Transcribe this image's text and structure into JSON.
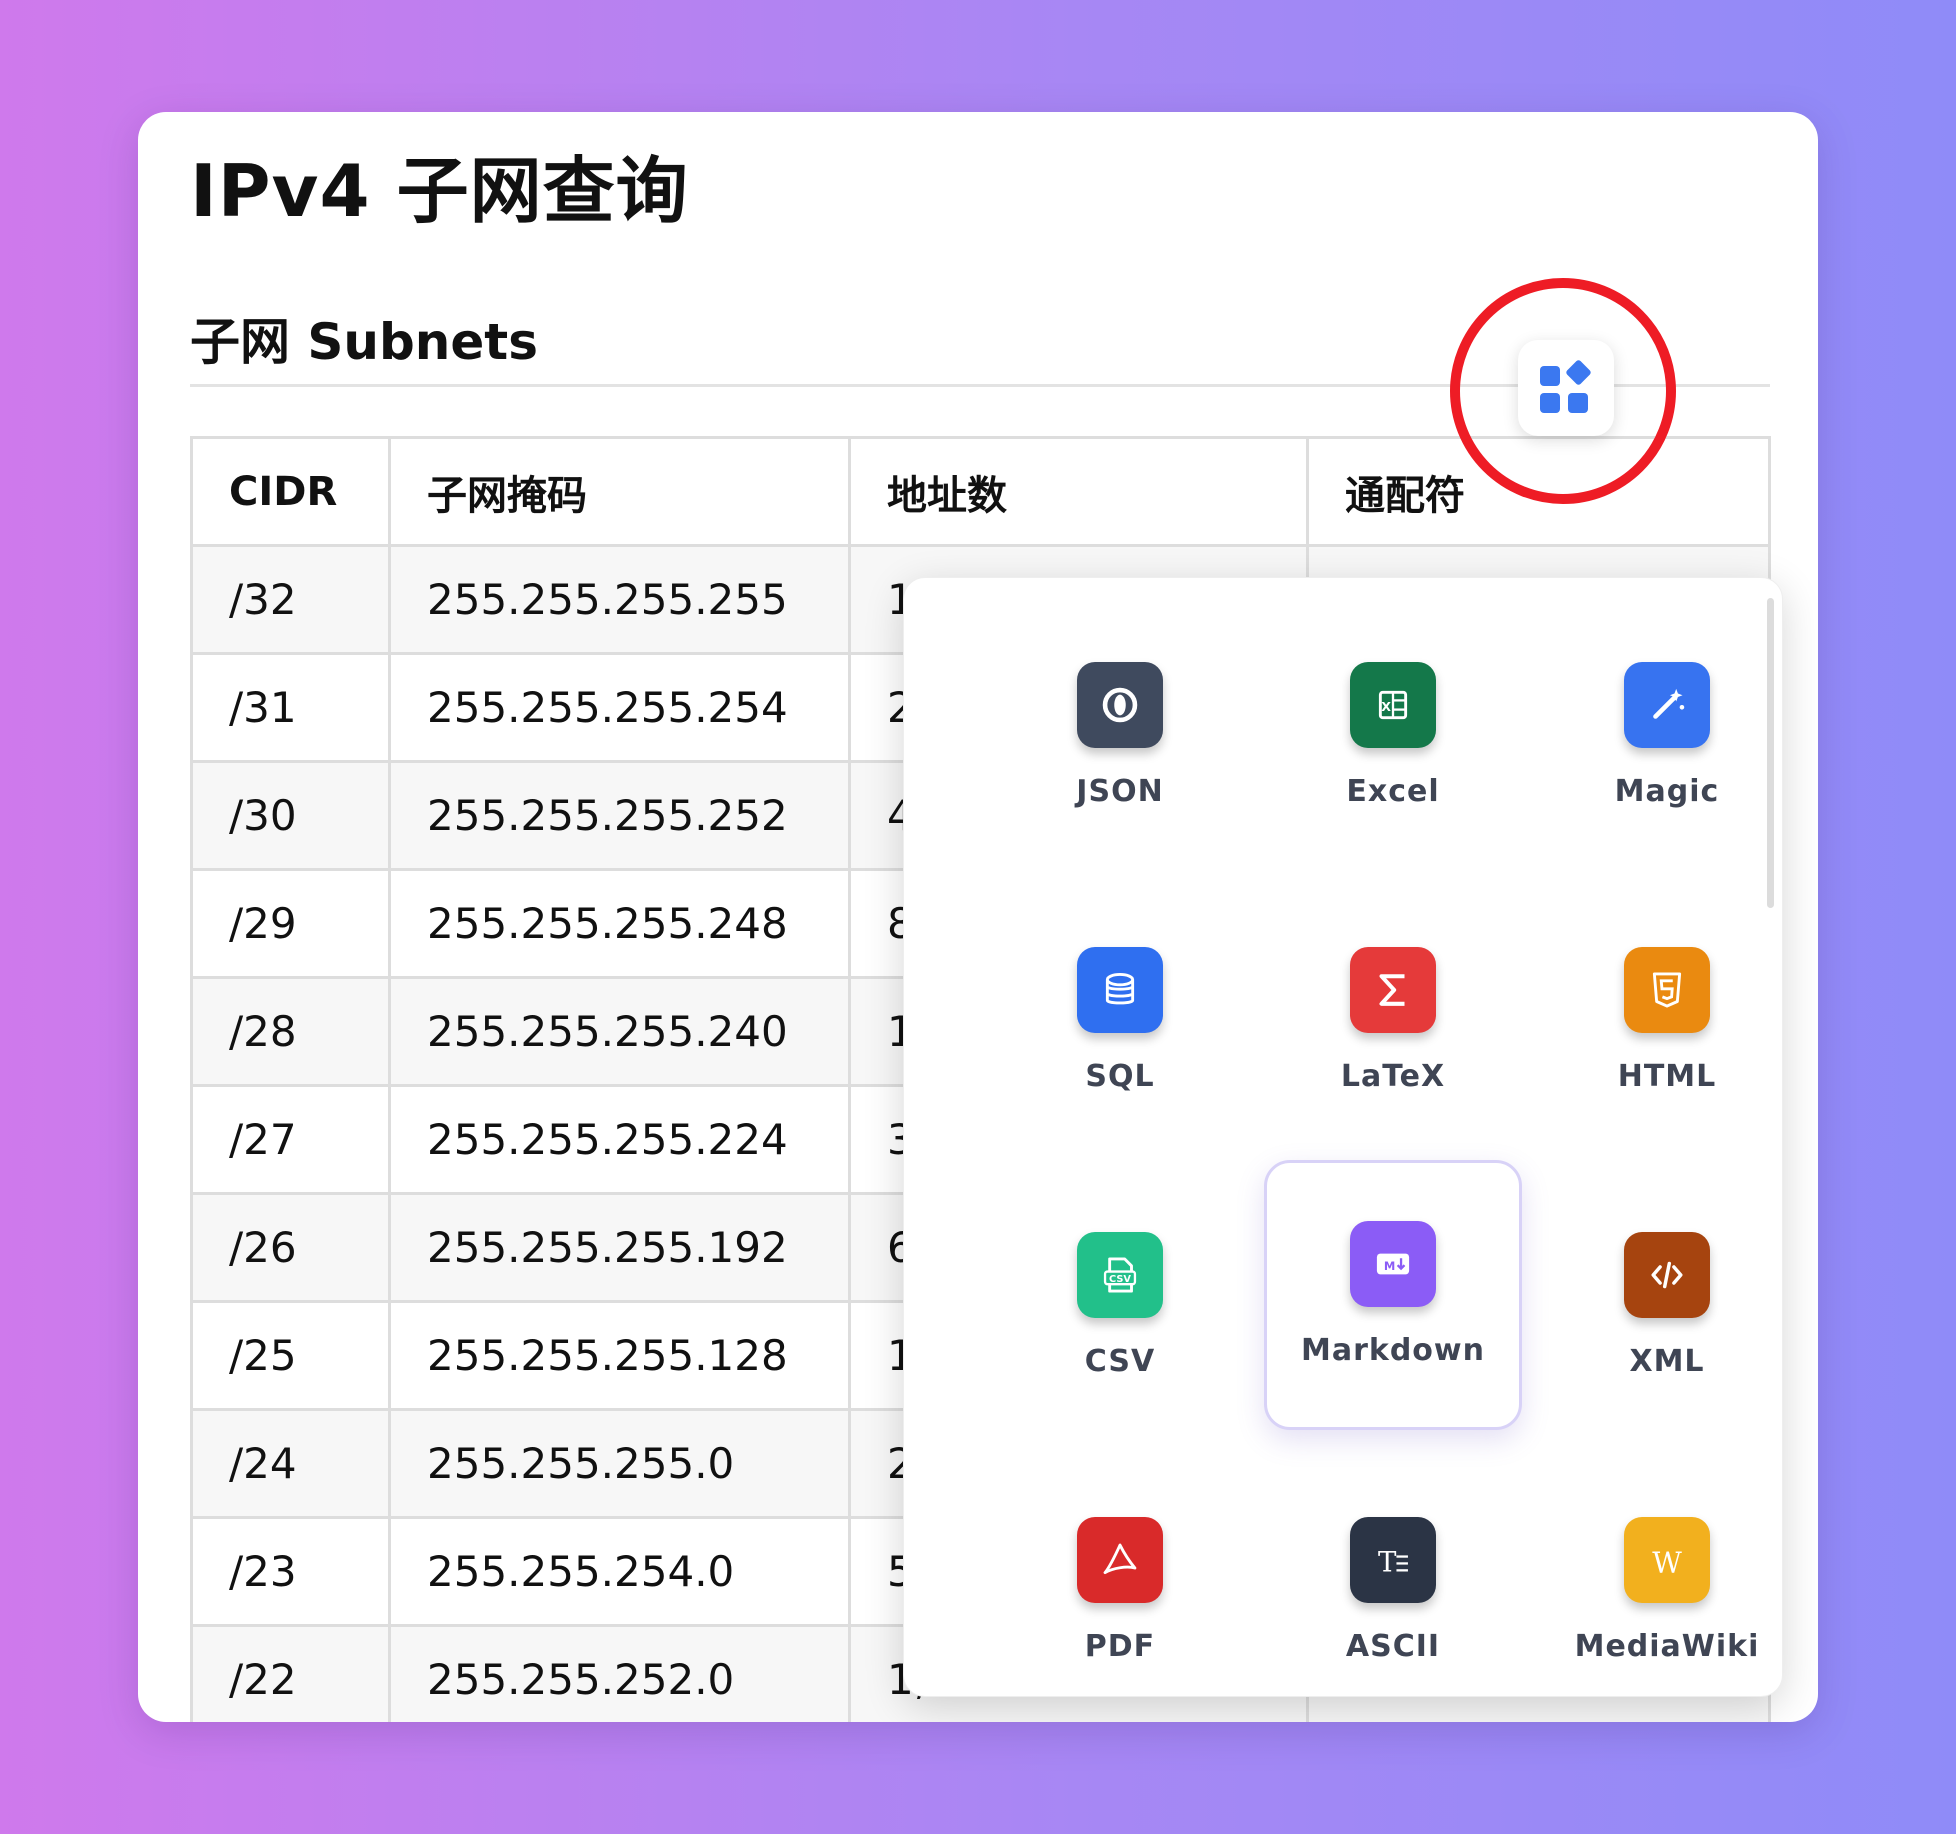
{
  "page": {
    "title": "IPv4 子网查询",
    "section_title": "子网 Subnets"
  },
  "table": {
    "headers": [
      "CIDR",
      "子网掩码",
      "地址数",
      "通配符"
    ],
    "rows": [
      [
        "/32",
        "255.255.255.255",
        "1",
        ""
      ],
      [
        "/31",
        "255.255.255.254",
        "2",
        ""
      ],
      [
        "/30",
        "255.255.255.252",
        "4",
        ""
      ],
      [
        "/29",
        "255.255.255.248",
        "8",
        ""
      ],
      [
        "/28",
        "255.255.255.240",
        "1",
        ""
      ],
      [
        "/27",
        "255.255.255.224",
        "3",
        ""
      ],
      [
        "/26",
        "255.255.255.192",
        "6",
        ""
      ],
      [
        "/25",
        "255.255.255.128",
        "1",
        ""
      ],
      [
        "/24",
        "255.255.255.0",
        "2",
        ""
      ],
      [
        "/23",
        "255.255.254.0",
        "5",
        ""
      ],
      [
        "/22",
        "255.255.252.0",
        "1,",
        ""
      ]
    ]
  },
  "tool_button": {
    "icon": "apps-grid-icon",
    "highlight_color": "#ee1c25"
  },
  "formats": [
    {
      "label": "JSON",
      "icon": "json-icon",
      "color": "#3f4a5e",
      "selected": false
    },
    {
      "label": "Excel",
      "icon": "excel-icon",
      "color": "#14784a",
      "selected": false
    },
    {
      "label": "Magic",
      "icon": "magic-wand-icon",
      "color": "#3773f0",
      "selected": false
    },
    {
      "label": "SQL",
      "icon": "database-icon",
      "color": "#2f6ff0",
      "selected": false
    },
    {
      "label": "LaTeX",
      "icon": "sigma-icon",
      "color": "#e53a3a",
      "selected": false
    },
    {
      "label": "HTML",
      "icon": "html5-icon",
      "color": "#ea8a10",
      "selected": false
    },
    {
      "label": "CSV",
      "icon": "csv-icon",
      "color": "#22c08a",
      "selected": false
    },
    {
      "label": "Markdown",
      "icon": "markdown-icon",
      "color": "#8b5cf6",
      "selected": true
    },
    {
      "label": "XML",
      "icon": "code-icon",
      "color": "#a6440f",
      "selected": false
    },
    {
      "label": "PDF",
      "icon": "pdf-icon",
      "color": "#d92a2a",
      "selected": false
    },
    {
      "label": "ASCII",
      "icon": "ascii-text-icon",
      "color": "#2b3445",
      "selected": false
    },
    {
      "label": "MediaWiki",
      "icon": "mediawiki-icon",
      "color": "#f2b01e",
      "selected": false
    }
  ]
}
